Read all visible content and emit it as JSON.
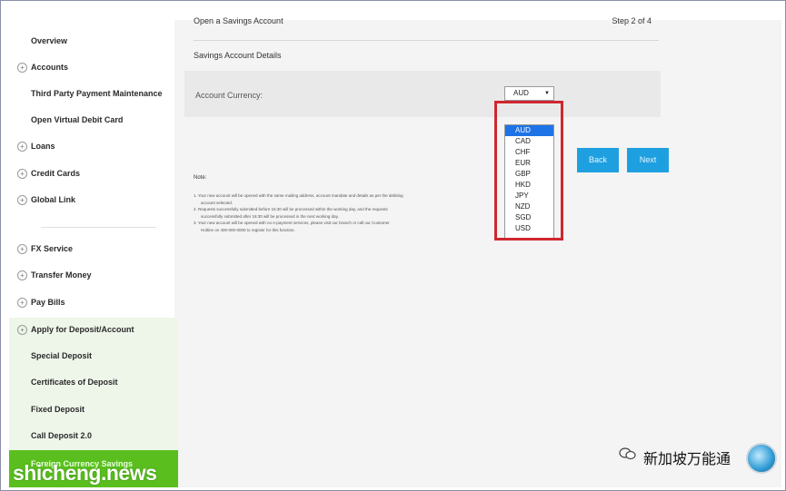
{
  "sidebar": {
    "items": [
      {
        "label": "Overview",
        "expandable": false
      },
      {
        "label": "Accounts",
        "expandable": true
      },
      {
        "label": "Third Party Payment Maintenance",
        "expandable": false
      },
      {
        "label": "Open Virtual Debit Card",
        "expandable": false
      },
      {
        "label": "Loans",
        "expandable": true
      },
      {
        "label": "Credit Cards",
        "expandable": true
      },
      {
        "label": "Global Link",
        "expandable": true
      },
      {
        "label": "FX Service",
        "expandable": true
      },
      {
        "label": "Transfer Money",
        "expandable": true
      },
      {
        "label": "Pay Bills",
        "expandable": true
      },
      {
        "label": "Apply for Deposit/Account",
        "expandable": true
      },
      {
        "label": "Special Deposit",
        "expandable": false
      },
      {
        "label": "Certificates of Deposit",
        "expandable": false
      },
      {
        "label": "Fixed Deposit",
        "expandable": false
      },
      {
        "label": "Call Deposit 2.0",
        "expandable": false
      }
    ],
    "active_label": "Foreign Currency Savings"
  },
  "header": {
    "title": "Open a Savings Account",
    "step": "Step 2 of 4"
  },
  "section": {
    "title": "Savings Account Details"
  },
  "field": {
    "label": "Account Currency:",
    "selected": "AUD",
    "options": [
      "AUD",
      "CAD",
      "CHF",
      "EUR",
      "GBP",
      "HKD",
      "JPY",
      "NZD",
      "SGD",
      "USD"
    ]
  },
  "buttons": {
    "back": "Back",
    "next": "Next"
  },
  "note": {
    "title": "Note:",
    "lines": [
      "1. Your new account will be opened with the same mailing address, account mandate and details as per the debiting",
      "account selected.",
      "2. Requests successfully submitted before 16:30 will be processed within the working day, and the requests",
      "successfully submitted after 16:30 will be processed in the next working day.",
      "3. Your new account will be opened with no e-payment services, please visit our branch or call our Customer",
      "Hotline on 400-000-0000 to register for this function."
    ]
  },
  "watermarks": {
    "left": "shicheng.news",
    "right": "新加坡万能通"
  },
  "colors": {
    "accent_blue": "#1ea0e0",
    "active_green": "#5abf1e",
    "highlight_red": "#d0262f",
    "selected_option": "#1e73e6"
  }
}
